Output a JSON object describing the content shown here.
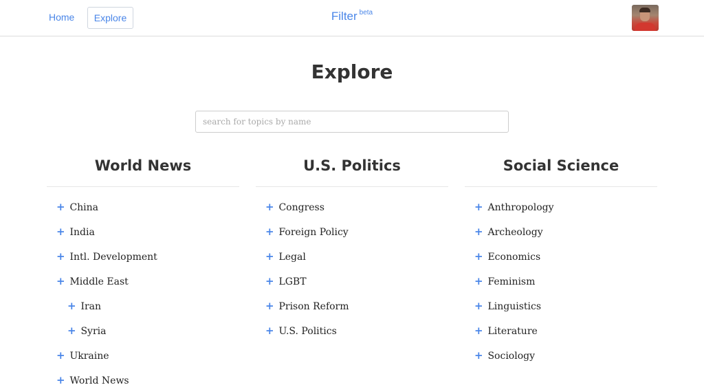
{
  "nav": {
    "home_label": "Home",
    "explore_label": "Explore",
    "brand": "Filter",
    "brand_badge": "beta"
  },
  "page": {
    "title": "Explore"
  },
  "search": {
    "placeholder": "search for topics by name",
    "value": ""
  },
  "colors": {
    "accent": "#4a86e8",
    "text": "#333333"
  },
  "icons": {
    "add": "plus-icon"
  },
  "columns": [
    {
      "title": "World News",
      "topics": [
        {
          "label": "China",
          "sub": false
        },
        {
          "label": "India",
          "sub": false
        },
        {
          "label": "Intl. Development",
          "sub": false
        },
        {
          "label": "Middle East",
          "sub": false
        },
        {
          "label": "Iran",
          "sub": true
        },
        {
          "label": "Syria",
          "sub": true
        },
        {
          "label": "Ukraine",
          "sub": false
        },
        {
          "label": "World News",
          "sub": false
        }
      ]
    },
    {
      "title": "U.S. Politics",
      "topics": [
        {
          "label": "Congress",
          "sub": false
        },
        {
          "label": "Foreign Policy",
          "sub": false
        },
        {
          "label": "Legal",
          "sub": false
        },
        {
          "label": "LGBT",
          "sub": false
        },
        {
          "label": "Prison Reform",
          "sub": false
        },
        {
          "label": "U.S. Politics",
          "sub": false
        }
      ]
    },
    {
      "title": "Social Science",
      "topics": [
        {
          "label": "Anthropology",
          "sub": false
        },
        {
          "label": "Archeology",
          "sub": false
        },
        {
          "label": "Economics",
          "sub": false
        },
        {
          "label": "Feminism",
          "sub": false
        },
        {
          "label": "Linguistics",
          "sub": false
        },
        {
          "label": "Literature",
          "sub": false
        },
        {
          "label": "Sociology",
          "sub": false
        }
      ]
    }
  ]
}
